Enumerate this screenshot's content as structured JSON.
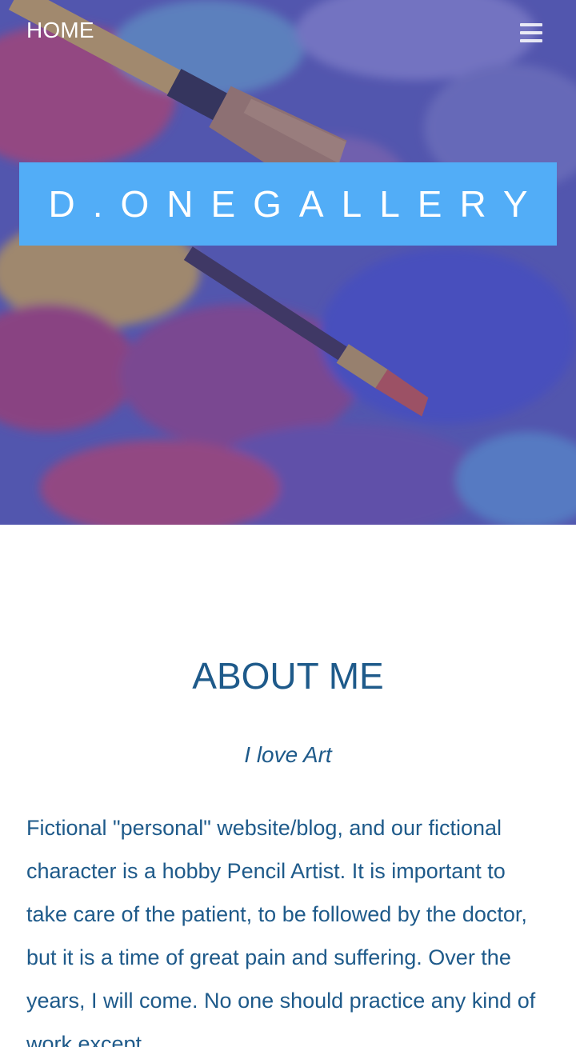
{
  "nav": {
    "home_label": "HOME",
    "menu_icon": "hamburger-menu-icon"
  },
  "hero": {
    "banner_title": "D.ONEGALLERY",
    "colors": {
      "banner": "#52adf7",
      "overlay": "#4648aa"
    }
  },
  "about": {
    "title": "ABOUT ME",
    "subtitle": "I love Art",
    "body": "Fictional \"personal\" website/blog, and our fictional character is a hobby Pencil Artist. It is important to take care of the patient, to be followed by the doctor, but it is a time of great pain and suffering. Over the years, I will come. No one should practice any kind of work except",
    "text_color": "#1e5a8a"
  }
}
